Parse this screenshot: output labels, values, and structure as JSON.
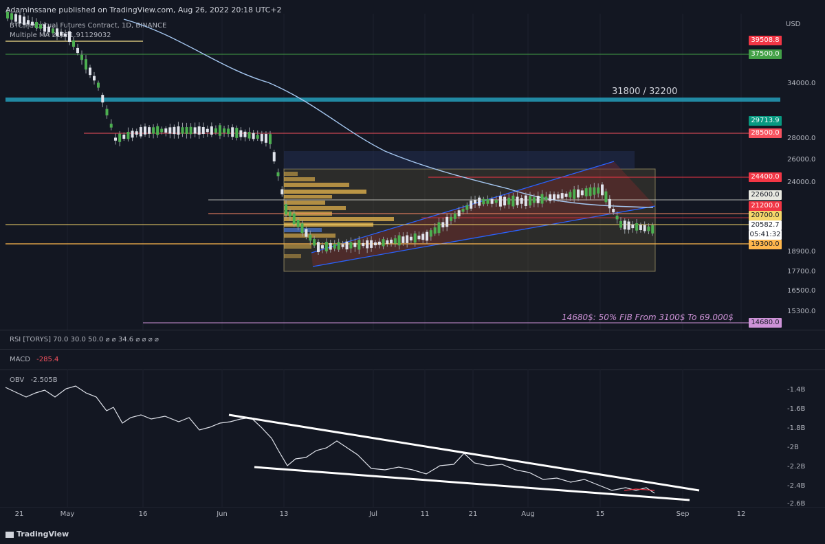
{
  "header": {
    "publisher_line": "Adaminssane published on TradingView.com, Aug 26, 2022 20:18 UTC+2",
    "symbol_line": "BTC Perpetual Futures Contract, 1D, BINANCE",
    "ma_line": "Multiple MA  21971.91129032",
    "currency": "USD"
  },
  "annotations": {
    "zone_label": "31800 / 32200",
    "fib_label": "14680$: 50% FIB From 3100$ To 69.000$"
  },
  "price_axis": {
    "ticks": [
      "34000.0",
      "28000.0",
      "26000.0",
      "24000.0",
      "18900.0",
      "17700.0",
      "16500.0",
      "15300.0"
    ]
  },
  "price_tags": [
    {
      "label": "39508.8",
      "color": "#f23645"
    },
    {
      "label": "37500.0",
      "color": "#43a047"
    },
    {
      "label": "29713.9",
      "color": "#089981"
    },
    {
      "label": "28500.0",
      "color": "#f7525f"
    },
    {
      "label": "24400.0",
      "color": "#f23645"
    },
    {
      "label": "22600.0",
      "color": "#e8e8e0"
    },
    {
      "label": "21200.0",
      "color": "#f23645"
    },
    {
      "label": "20700.0",
      "color": "#f5d66a"
    },
    {
      "label": "20582.7",
      "color": "#ffffff"
    },
    {
      "label": "05:41:32",
      "color": "#ffffff"
    },
    {
      "label": "19300.0",
      "color": "#ffb74d"
    },
    {
      "label": "14680.0",
      "color": "#ce93d8"
    }
  ],
  "indicators": {
    "rsi": "RSI [TORYS]  70.0  30.0  50.0  ⌀  ⌀  34.6  ⌀  ⌀  ⌀  ⌀",
    "macd_label": "MACD",
    "macd_value": "-285.4",
    "obv_label": "OBV",
    "obv_value": "-2.505B"
  },
  "time_axis": [
    "21",
    "May",
    "16",
    "Jun",
    "13",
    "Jul",
    "11",
    "21",
    "Aug",
    "15",
    "Sep",
    "12"
  ],
  "footer": {
    "brand": "TradingView"
  },
  "chart_data": {
    "type": "candlestick",
    "title": "BTC Perpetual Futures Contract, 1D, BINANCE",
    "currency": "USD",
    "horizontal_levels": [
      39508.8,
      37500.0,
      31800,
      32200,
      28500.0,
      24400.0,
      22600.0,
      21200.0,
      20700.0,
      19300.0,
      14680.0
    ],
    "last_price": 20582.7,
    "ma_value": 21971.91129032,
    "price_series_approx": [
      {
        "x": "Apr 21",
        "close": 40500
      },
      {
        "x": "May 1",
        "close": 38500
      },
      {
        "x": "May 9",
        "close": 34000
      },
      {
        "x": "May 12",
        "close": 29000
      },
      {
        "x": "May 16",
        "close": 29800
      },
      {
        "x": "Jun 1",
        "close": 29800
      },
      {
        "x": "Jun 10",
        "close": 29000
      },
      {
        "x": "Jun 13",
        "close": 22500
      },
      {
        "x": "Jun 18",
        "close": 19000
      },
      {
        "x": "Jul 1",
        "close": 19300
      },
      {
        "x": "Jul 11",
        "close": 20000
      },
      {
        "x": "Jul 21",
        "close": 23200
      },
      {
        "x": "Aug 1",
        "close": 23300
      },
      {
        "x": "Aug 15",
        "close": 24300
      },
      {
        "x": "Aug 19",
        "close": 21100
      },
      {
        "x": "Aug 26",
        "close": 20582.7
      }
    ],
    "obv_axis": [
      "-1.4B",
      "-1.6B",
      "-1.8B",
      "-2B",
      "-2.2B",
      "-2.4B",
      "-2.6B"
    ],
    "obv_value": -2.505
  }
}
